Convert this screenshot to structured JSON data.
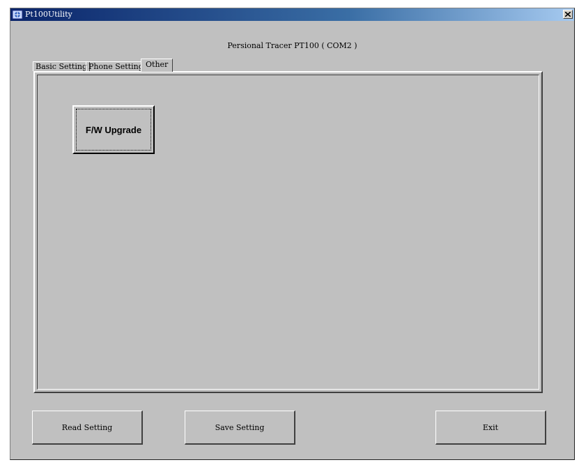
{
  "window": {
    "title": "Pt100Utility",
    "close_glyph": "×"
  },
  "header": {
    "device_label": "Persional Tracer PT100 ( COM2 )"
  },
  "tabs": [
    {
      "label": "Basic Setting"
    },
    {
      "label": "Phone Setting"
    },
    {
      "label": "Other",
      "active": true
    }
  ],
  "other_tab": {
    "fw_upgrade_label": "F/W Upgrade"
  },
  "footer": {
    "read_label": "Read Setting",
    "save_label": "Save Setting",
    "exit_label": "Exit"
  }
}
